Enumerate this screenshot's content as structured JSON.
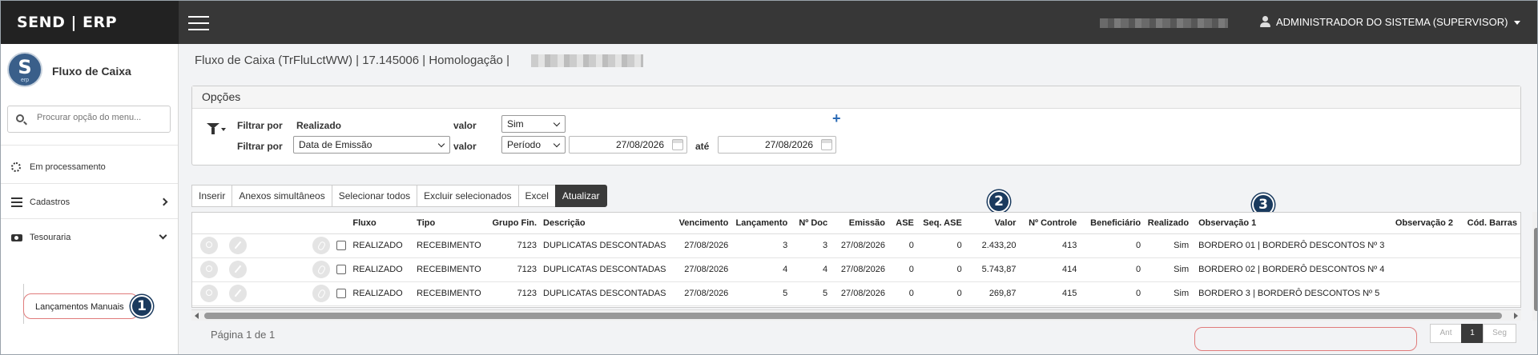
{
  "app": {
    "brand": "SEND | ERP",
    "user_label": "ADMINISTRADOR DO SISTEMA (SUPERVISOR)"
  },
  "sidebar": {
    "module_title": "Fluxo de Caixa",
    "search_placeholder": "Procurar opção do menu...",
    "items": [
      {
        "label": "Em processamento",
        "icon": "spinner-icon"
      },
      {
        "label": "Cadastros",
        "icon": "list-icon"
      },
      {
        "label": "Tesouraria",
        "icon": "cash-icon"
      }
    ],
    "subitem": "Lançamentos Manuais",
    "badge_1": "1"
  },
  "main": {
    "title": "Fluxo de Caixa (TrFluLctWW) | 17.145006 | Homologação |",
    "options_header": "Opções",
    "filter1": {
      "label": "Filtrar por",
      "value": "Realizado",
      "valor_label": "valor",
      "select": "Sim"
    },
    "filter2": {
      "label": "Filtrar por",
      "select": "Data de Emissão",
      "valor_label": "valor",
      "period": "Período",
      "date_from": "27/08/2026",
      "ate_label": "até",
      "date_to": "27/08/2026"
    },
    "toolbar": [
      "Inserir",
      "Anexos simultâneos",
      "Selecionar todos",
      "Excluir selecionados",
      "Excel",
      "Atualizar"
    ],
    "badge_2": "2",
    "badge_3": "3",
    "grid": {
      "headers": [
        "Fluxo",
        "Tipo",
        "Grupo Fin.",
        "Descrição",
        "Vencimento",
        "Lançamento",
        "Nº Doc",
        "Emissão",
        "ASE",
        "Seq. ASE",
        "Valor",
        "Nº Controle",
        "Beneficiário",
        "Realizado",
        "Observação 1",
        "Observação 2",
        "Cód. Barras"
      ],
      "rows": [
        [
          "REALIZADO",
          "RECEBIMENTO",
          "7123",
          "DUPLICATAS DESCONTADAS",
          "27/08/2026",
          "3",
          "3",
          "27/08/2026",
          "0",
          "0",
          "2.433,20",
          "413",
          "0",
          "Sim",
          "BORDERO 01 | BORDERÔ DESCONTOS Nº 3",
          "",
          ""
        ],
        [
          "REALIZADO",
          "RECEBIMENTO",
          "7123",
          "DUPLICATAS DESCONTADAS",
          "27/08/2026",
          "4",
          "4",
          "27/08/2026",
          "0",
          "0",
          "5.743,87",
          "414",
          "0",
          "Sim",
          "BORDERO 02 | BORDERÔ DESCONTOS Nº 4",
          "",
          ""
        ],
        [
          "REALIZADO",
          "RECEBIMENTO",
          "7123",
          "DUPLICATAS DESCONTADAS",
          "27/08/2026",
          "5",
          "5",
          "27/08/2026",
          "0",
          "0",
          "269,87",
          "415",
          "0",
          "Sim",
          "BORDERO 3 | BORDERÔ DESCONTOS Nº 5",
          "",
          ""
        ]
      ]
    },
    "pager": {
      "text": "Página 1 de 1",
      "prev": "Ant",
      "current": "1",
      "next": "Seg"
    }
  }
}
